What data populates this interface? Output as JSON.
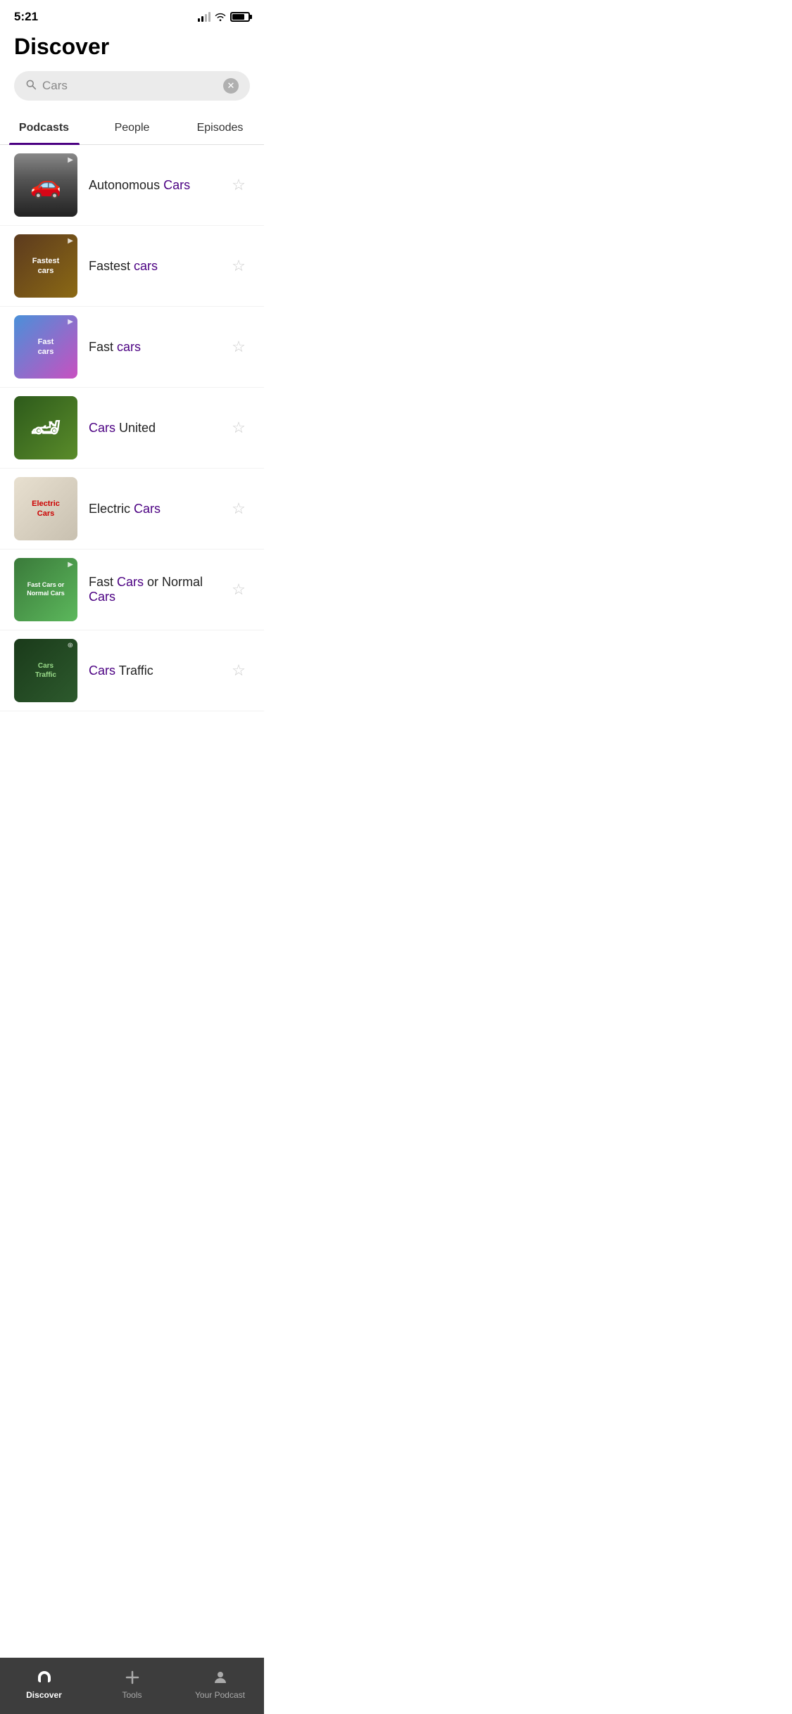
{
  "status": {
    "time": "5:21"
  },
  "header": {
    "title": "Discover"
  },
  "search": {
    "placeholder": "Cars",
    "value": "Cars"
  },
  "tabs": [
    {
      "id": "podcasts",
      "label": "Podcasts",
      "active": true
    },
    {
      "id": "people",
      "label": "People",
      "active": false
    },
    {
      "id": "episodes",
      "label": "Episodes",
      "active": false
    }
  ],
  "results": [
    {
      "id": "autonomous-cars",
      "name_plain": "Autonomous ",
      "name_highlight": "Cars",
      "name_suffix": "",
      "thumb_class": "thumb-autonomous",
      "thumb_label": "🚗",
      "thumb_text": ""
    },
    {
      "id": "fastest-cars",
      "name_plain": "Fastest ",
      "name_highlight": "cars",
      "name_suffix": "",
      "thumb_class": "thumb-fastest",
      "thumb_text": "Fastest cars"
    },
    {
      "id": "fast-cars",
      "name_plain": "Fast ",
      "name_highlight": "cars",
      "name_suffix": "",
      "thumb_class": "thumb-fast",
      "thumb_text": "Fast cars"
    },
    {
      "id": "cars-united",
      "name_plain": " United",
      "name_highlight": "Cars",
      "name_prefix": true,
      "thumb_class": "thumb-united",
      "thumb_text": ""
    },
    {
      "id": "electric-cars",
      "name_plain": "Electric ",
      "name_highlight": "Cars",
      "name_suffix": "",
      "thumb_class": "thumb-electric",
      "thumb_text": "Electric Cars"
    },
    {
      "id": "fast-cars-normal",
      "name_parts": [
        "Fast ",
        "Cars",
        " or Normal ",
        "Cars"
      ],
      "thumb_class": "thumb-fastcars",
      "thumb_text": "Fast Cars or Normal Cars"
    },
    {
      "id": "cars-traffic",
      "name_parts": [
        "Cars",
        " Traffic"
      ],
      "name_prefix_highlight": true,
      "thumb_class": "thumb-traffic",
      "thumb_text": "Cars Traffic"
    }
  ],
  "bottom_nav": [
    {
      "id": "discover",
      "label": "Discover",
      "icon": "headphones",
      "active": true
    },
    {
      "id": "tools",
      "label": "Tools",
      "icon": "plus",
      "active": false
    },
    {
      "id": "your-podcast",
      "label": "Your Podcast",
      "icon": "person",
      "active": false
    }
  ]
}
